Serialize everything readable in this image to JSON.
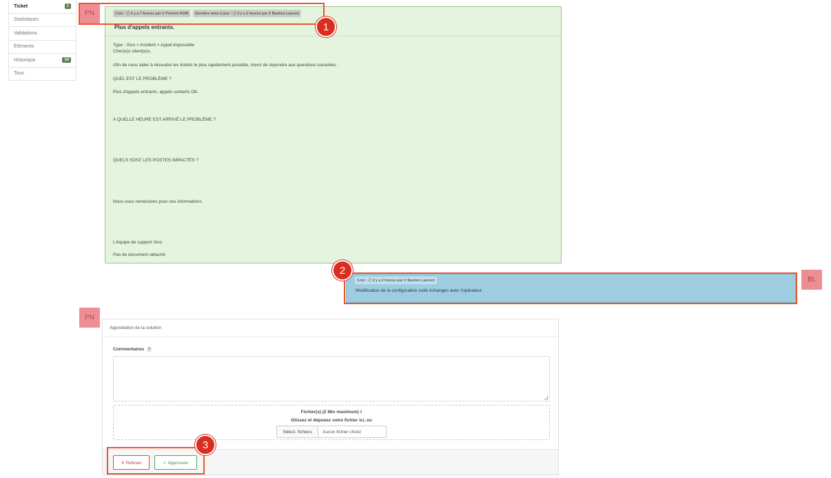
{
  "sidebar": {
    "items": [
      {
        "label": "Ticket",
        "badge": "1"
      },
      {
        "label": "Statistiques"
      },
      {
        "label": "Validations"
      },
      {
        "label": "Éléments"
      },
      {
        "label": "Historique",
        "badge": "14"
      },
      {
        "label": "Tous"
      }
    ]
  },
  "ticket": {
    "avatar": "PN",
    "created_badge": "Créé : ⓘ il y a 7 heures par  ⚲ Prénom NOM",
    "updated_badge": "Dernière mise à jour : ⓘ il y a 2 heures par  ⚲ Bastien Laurent",
    "title": "Plus d'appels entrants.",
    "lines": [
      "Type : Xivo > incident > Appel impossible",
      "Cher(e)s client(e)s,",
      "Afin de nous aider à résoudre les tickets le plus rapidement possible, merci de répondre aux questions suivantes :",
      "QUEL EST LE PROBLÈME ?",
      " Plus d'appels entrants, appels sortants OK.",
      "A QUELLE HEURE EST ARRIVÉ LE PROBLÈME ?",
      "QUELS SONT LES POSTES IMPACTÉS ?",
      "Nous vous remercions pour ces informations.",
      "L'équipe de support Xivo",
      "Pas de document rattaché"
    ]
  },
  "followup": {
    "avatar": "BL",
    "badge": "Créé : ⓘ il y a 2 heures par  ⚲ Bastien Laurent",
    "text": "Modification de la configuration suite échanges avec l'opérateur."
  },
  "approval": {
    "avatar": "PN",
    "header": "Approbation de la solution",
    "comments_label": "Commentaires",
    "help_glyph": "?",
    "files_label": "Fichier(s) (2 Mio maximum)",
    "files_help_glyph": "ℹ",
    "drop_text": "Glissez et déposez votre fichier ici, ou",
    "select_button": "Sélect. fichiers",
    "no_file": "Aucun fichier choisi",
    "refuse_label": "✕ Refuser",
    "approve_label": "✓ Approuver"
  },
  "markers": [
    "1",
    "2",
    "3"
  ],
  "colors": {
    "ticket_bg": "#e5f4df",
    "followup_bg": "#9ecde2",
    "highlight": "#e8562d",
    "marker": "#d92d20",
    "refuse": "#c33d3d",
    "approve": "#3e8f43"
  }
}
